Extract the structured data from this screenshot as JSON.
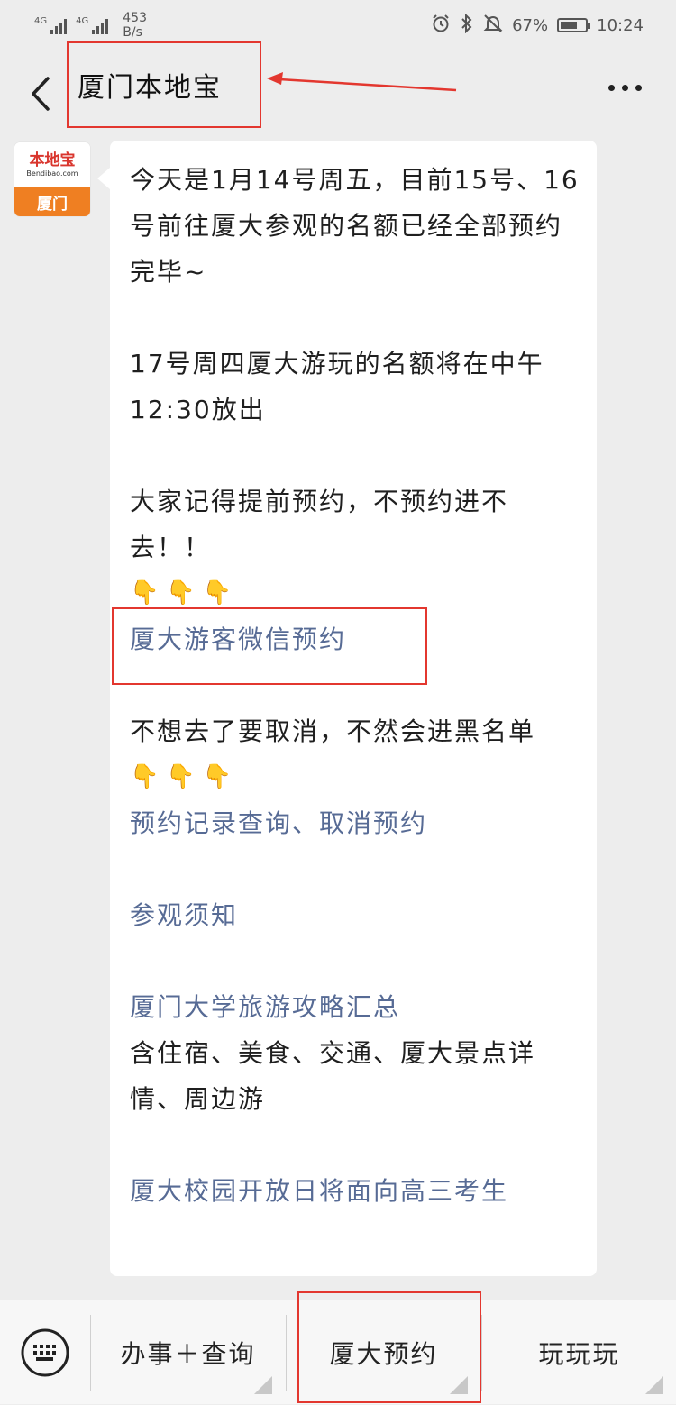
{
  "status_bar": {
    "net1": "4G",
    "net2": "4G",
    "speed_value": "453",
    "speed_unit": "B/s",
    "battery": "67%",
    "battery_level": 0.67,
    "time": "10:24",
    "icons": [
      "alarm-icon",
      "bluetooth-icon",
      "mute-icon",
      "battery-icon"
    ]
  },
  "header": {
    "title": "厦门本地宝",
    "icons": [
      "back-icon",
      "more-icon"
    ]
  },
  "avatar": {
    "brand": "本地宝",
    "site": "Bendibao.com",
    "city": "厦门"
  },
  "message": {
    "p1": "今天是1月14号周五，目前15号、16号前往厦大参观的名额已经全部预约完毕~",
    "p2": "17号周四厦大游玩的名额将在中午12:30放出",
    "p3": "大家记得提前预约，不预约进不去！！",
    "hands1": "👇👇👇",
    "link1": "厦大游客微信预约",
    "p4": "不想去了要取消，不然会进黑名单",
    "hands2": "👇👇👇",
    "link2": "预约记录查询、取消预约",
    "link3": "参观须知",
    "link4": "厦门大学旅游攻略汇总",
    "p5": "含住宿、美食、交通、厦大景点详情、周边游",
    "link5": "厦大校园开放日将面向高三考生"
  },
  "menu": {
    "item1": "办事＋查询",
    "item2": "厦大预约",
    "item3": "玩玩玩",
    "icons": [
      "keyboard-icon"
    ]
  },
  "colors": {
    "link": "#576b95",
    "highlight": "#e3372f",
    "avatar_orange": "#ef7f22",
    "avatar_brand": "#d9352d"
  }
}
